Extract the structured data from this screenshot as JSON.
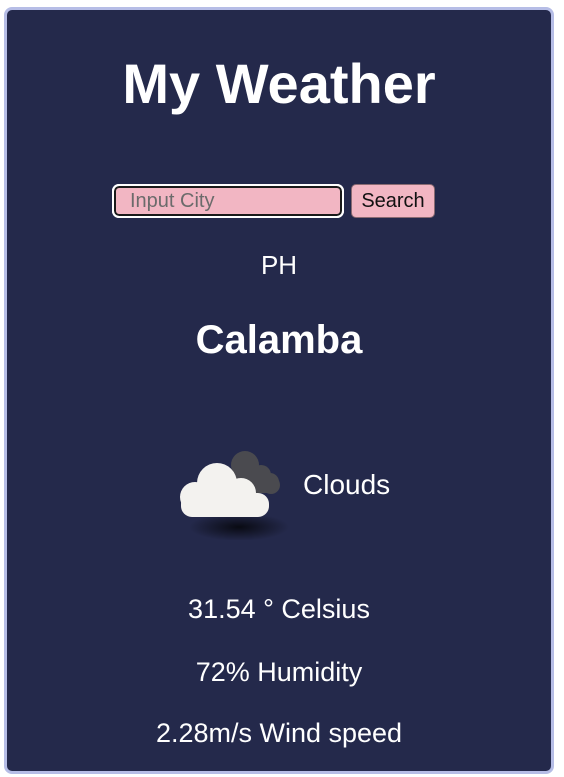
{
  "app": {
    "title": "My Weather"
  },
  "search": {
    "placeholder": "Input City",
    "value": "",
    "button_label": "Search"
  },
  "location": {
    "country": "PH",
    "city": "Calamba"
  },
  "condition": {
    "label": "Clouds",
    "icon": "clouds-icon"
  },
  "stats": {
    "temperature": "31.54 ° Celsius",
    "humidity": "72% Humidity",
    "wind": "2.28m/s Wind speed"
  },
  "colors": {
    "card_background": "#24294b",
    "card_border": "#b6bde6",
    "input_background": "#f2b6c3",
    "text": "#ffffff"
  }
}
